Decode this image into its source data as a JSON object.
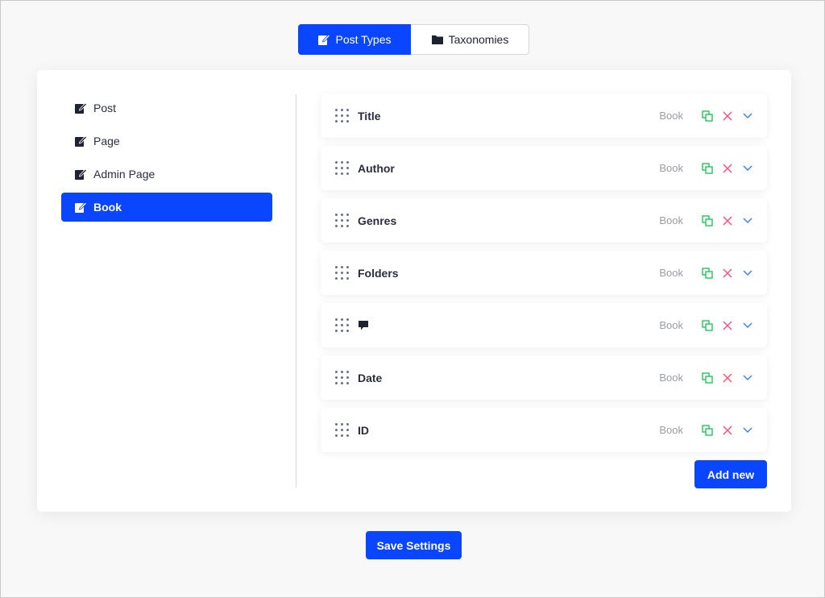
{
  "top_tabs": [
    {
      "label": "Post Types",
      "icon": "edit-icon",
      "active": true
    },
    {
      "label": "Taxonomies",
      "icon": "folder-icon",
      "active": false
    }
  ],
  "sidebar": {
    "items": [
      {
        "label": "Post",
        "icon": "edit-icon"
      },
      {
        "label": "Page",
        "icon": "edit-icon"
      },
      {
        "label": "Admin Page",
        "icon": "edit-icon"
      },
      {
        "label": "Book",
        "icon": "edit-icon",
        "active": true
      }
    ]
  },
  "fields": [
    {
      "label": "Title",
      "type": "Book"
    },
    {
      "label": "Author",
      "type": "Book"
    },
    {
      "label": "Genres",
      "type": "Book"
    },
    {
      "label": "Folders",
      "type": "Book"
    },
    {
      "label": "",
      "icon": "comment-icon",
      "type": "Book"
    },
    {
      "label": "Date",
      "type": "Book"
    },
    {
      "label": "ID",
      "type": "Book"
    }
  ],
  "actions": {
    "add_label": "Add new",
    "save_label": "Save Settings"
  },
  "colors": {
    "accent": "#0a46ff",
    "duplicate": "#22c55e",
    "delete": "#f0567a",
    "expand": "#3b82f6"
  }
}
